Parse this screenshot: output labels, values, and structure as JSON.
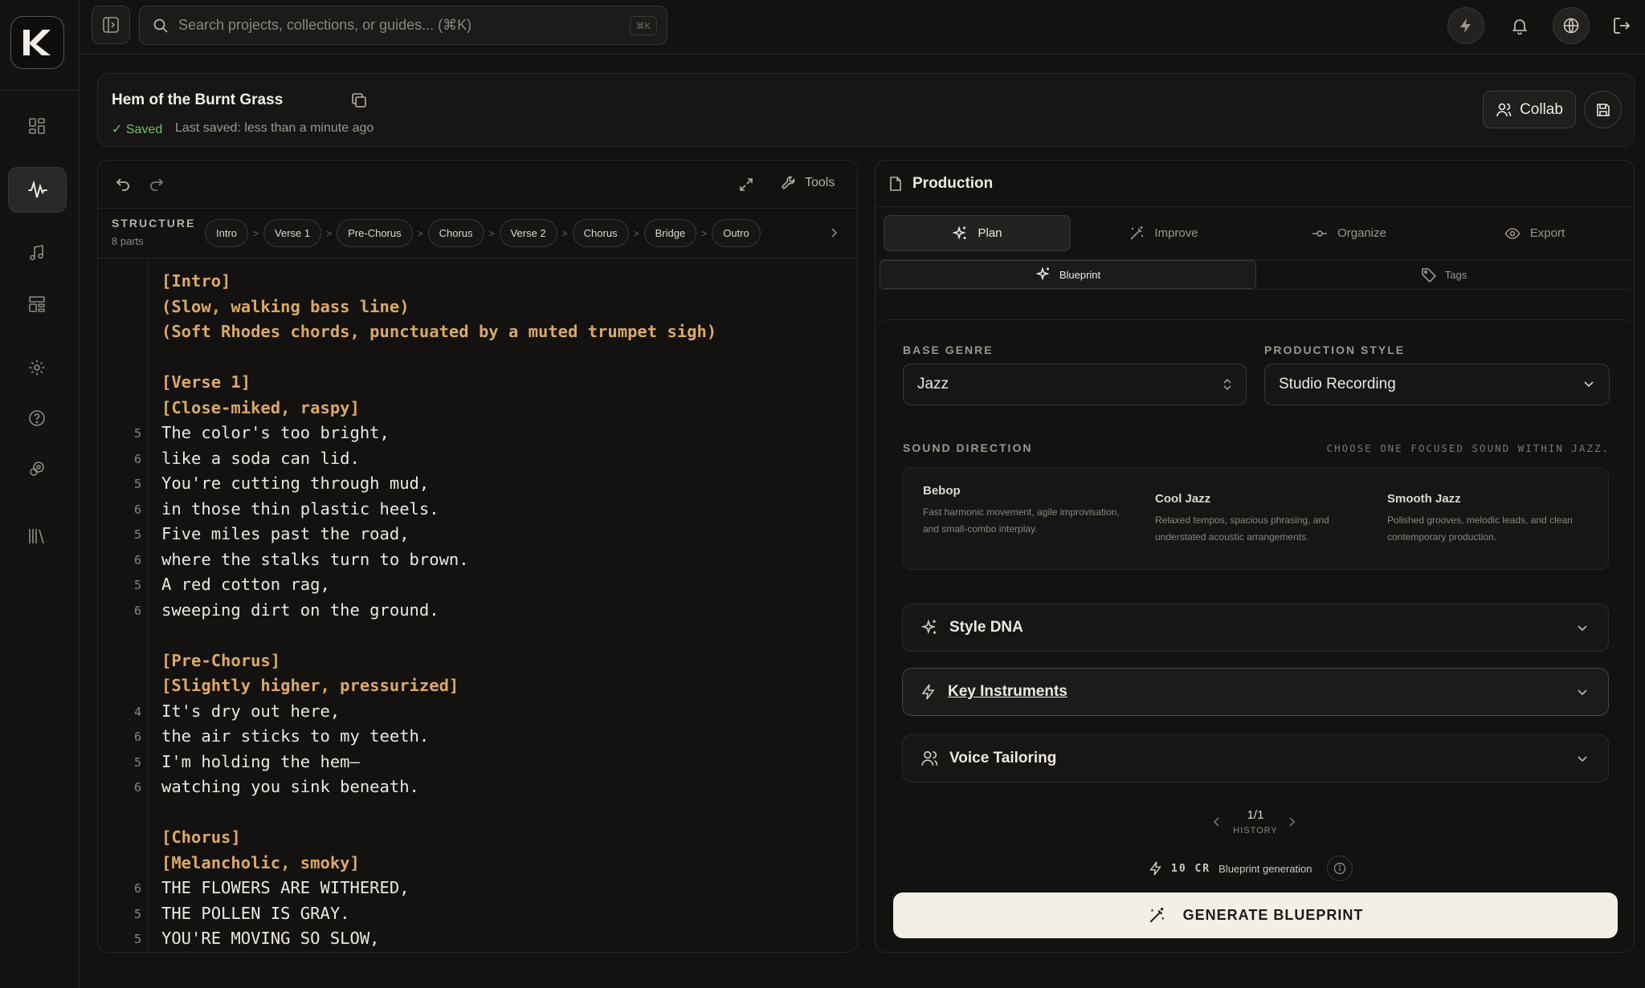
{
  "search": {
    "placeholder": "Search projects, collections, or guides... (⌘K)",
    "kbd": "⌘K"
  },
  "header": {
    "title": "Hem of the Burnt Grass",
    "saved": "✓ Saved",
    "last_saved": "Last saved: less than a minute ago",
    "collab_label": "Collab"
  },
  "editor": {
    "tools_label": "Tools",
    "structure_label": "STRUCTURE",
    "structure_sub": "8 parts",
    "chips": [
      "Intro",
      "Verse 1",
      "Pre-Chorus",
      "Chorus",
      "Verse 2",
      "Chorus",
      "Bridge",
      "Outro"
    ],
    "lines": [
      {
        "num": "",
        "text": "[Intro]",
        "tag": true
      },
      {
        "num": "",
        "text": "(Slow, walking bass line)",
        "tag": true
      },
      {
        "num": "",
        "text": "(Soft Rhodes chords, punctuated by a muted trumpet sigh)",
        "tag": true
      },
      {
        "num": "",
        "text": "",
        "tag": false
      },
      {
        "num": "",
        "text": "[Verse 1]",
        "tag": true
      },
      {
        "num": "",
        "text": "[Close-miked, raspy]",
        "tag": true
      },
      {
        "num": "5",
        "text": "The color's too bright,",
        "tag": false
      },
      {
        "num": "6",
        "text": "like a soda can lid.",
        "tag": false
      },
      {
        "num": "5",
        "text": "You're cutting through mud,",
        "tag": false
      },
      {
        "num": "6",
        "text": "in those thin plastic heels.",
        "tag": false
      },
      {
        "num": "5",
        "text": "Five miles past the road,",
        "tag": false
      },
      {
        "num": "6",
        "text": "where the stalks turn to brown.",
        "tag": false
      },
      {
        "num": "5",
        "text": "A red cotton rag,",
        "tag": false
      },
      {
        "num": "6",
        "text": "sweeping dirt on the ground.",
        "tag": false
      },
      {
        "num": "",
        "text": "",
        "tag": false
      },
      {
        "num": "",
        "text": "[Pre-Chorus]",
        "tag": true
      },
      {
        "num": "",
        "text": "[Slightly higher, pressurized]",
        "tag": true
      },
      {
        "num": "4",
        "text": "It's dry out here,",
        "tag": false
      },
      {
        "num": "6",
        "text": "the air sticks to my teeth.",
        "tag": false
      },
      {
        "num": "5",
        "text": "I'm holding the hem—",
        "tag": false
      },
      {
        "num": "6",
        "text": "watching you sink beneath.",
        "tag": false
      },
      {
        "num": "",
        "text": "",
        "tag": false
      },
      {
        "num": "",
        "text": "[Chorus]",
        "tag": true
      },
      {
        "num": "",
        "text": "[Melancholic, smoky]",
        "tag": true
      },
      {
        "num": "6",
        "text": "THE FLOWERS ARE WITHERED,",
        "tag": false
      },
      {
        "num": "5",
        "text": "THE POLLEN IS GRAY.",
        "tag": false
      },
      {
        "num": "5",
        "text": "YOU'RE MOVING SO SLOW,",
        "tag": false
      }
    ]
  },
  "production": {
    "title": "Production",
    "tabs": [
      "Plan",
      "Improve",
      "Organize",
      "Export"
    ],
    "subtabs": [
      "Blueprint",
      "Tags"
    ],
    "base_genre_label": "BASE GENRE",
    "base_genre_value": "Jazz",
    "production_style_label": "PRODUCTION STYLE",
    "production_style_value": "Studio Recording",
    "sound_direction_label": "SOUND DIRECTION",
    "sound_direction_hint": "CHOOSE ONE FOCUSED SOUND WITHIN JAZZ.",
    "sounds": [
      {
        "title": "Bebop",
        "desc": "Fast harmonic movement, agile improvisation, and small-combo interplay."
      },
      {
        "title": "Cool Jazz",
        "desc": "Relaxed tempos, spacious phrasing, and understated acoustic arrangements."
      },
      {
        "title": "Smooth Jazz",
        "desc": "Polished grooves, melodic leads, and clean contemporary production."
      }
    ],
    "accordions": [
      "Style DNA",
      "Key Instruments",
      "Voice Tailoring"
    ],
    "history_value": "1/1",
    "history_label": "HISTORY",
    "cost": "10 CR",
    "cost_label": "Blueprint generation",
    "generate_label": "GENERATE BLUEPRINT"
  }
}
